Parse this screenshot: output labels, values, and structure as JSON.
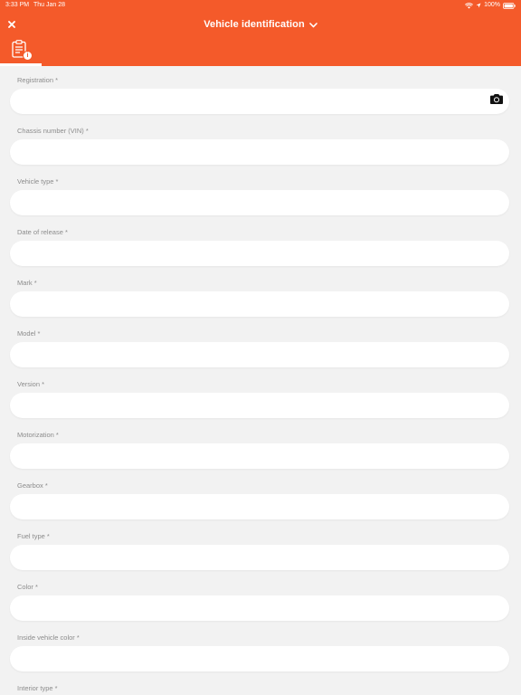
{
  "status_bar": {
    "time": "3:33 PM",
    "date": "Thu Jan 28",
    "battery": "100%",
    "icons": [
      "wifi-icon",
      "location-icon",
      "battery-icon"
    ]
  },
  "header": {
    "title": "Vehicle identification",
    "close_icon": "close-icon",
    "dropdown_icon": "chevron-down-icon",
    "tab": {
      "icon": "clipboard-icon",
      "badge": "i"
    },
    "colors": {
      "background": "#f45a2a",
      "text": "#ffffff"
    }
  },
  "form": {
    "fields": [
      {
        "label": "Registration *",
        "value": "",
        "has_camera": true
      },
      {
        "label": "Chassis number (VIN) *",
        "value": ""
      },
      {
        "label": "Vehicle type *",
        "value": ""
      },
      {
        "label": "Date of release *",
        "value": ""
      },
      {
        "label": "Mark *",
        "value": ""
      },
      {
        "label": "Model *",
        "value": ""
      },
      {
        "label": "Version *",
        "value": ""
      },
      {
        "label": "Motorization *",
        "value": ""
      },
      {
        "label": "Gearbox *",
        "value": ""
      },
      {
        "label": "Fuel type *",
        "value": ""
      },
      {
        "label": "Color *",
        "value": ""
      },
      {
        "label": "Inside vehicle color *",
        "value": ""
      },
      {
        "label": "Interior type *",
        "value": ""
      }
    ],
    "camera_icon": "camera-icon",
    "colors": {
      "background": "#f2f2f2",
      "input": "#ffffff",
      "label": "#8c8c8c"
    }
  }
}
